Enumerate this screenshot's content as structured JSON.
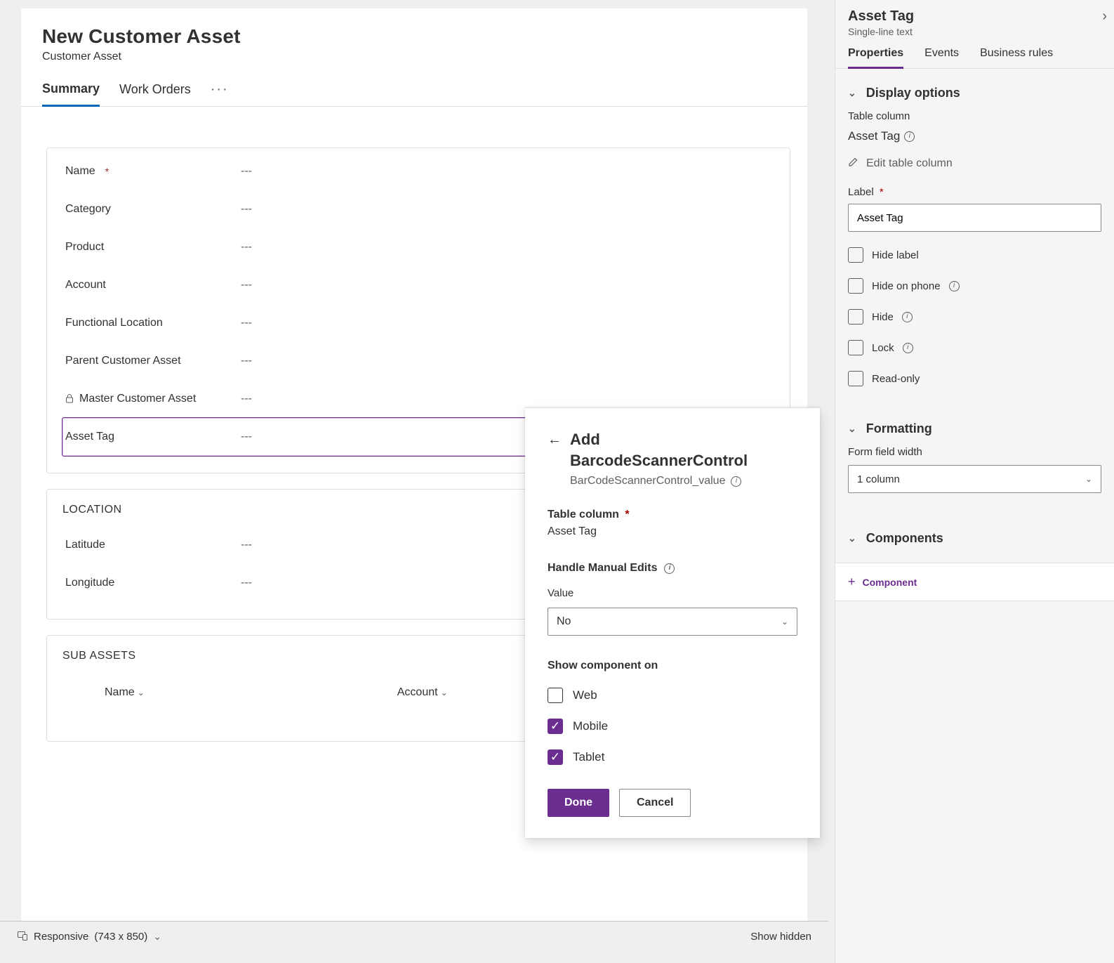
{
  "form": {
    "title": "New Customer Asset",
    "subtitle": "Customer Asset",
    "tabs": [
      {
        "label": "Summary",
        "active": true
      },
      {
        "label": "Work Orders",
        "active": false
      }
    ],
    "fields": [
      {
        "label": "Name",
        "required": true,
        "value": "---",
        "locked": false
      },
      {
        "label": "Category",
        "required": false,
        "value": "---",
        "locked": false
      },
      {
        "label": "Product",
        "required": false,
        "value": "---",
        "locked": false
      },
      {
        "label": "Account",
        "required": false,
        "value": "---",
        "locked": false
      },
      {
        "label": "Functional Location",
        "required": false,
        "value": "---",
        "locked": false
      },
      {
        "label": "Parent Customer Asset",
        "required": false,
        "value": "---",
        "locked": false
      },
      {
        "label": "Master Customer Asset",
        "required": false,
        "value": "---",
        "locked": true
      },
      {
        "label": "Asset Tag",
        "required": false,
        "value": "---",
        "locked": false,
        "selected": true
      }
    ],
    "location": {
      "title": "LOCATION",
      "fields": [
        {
          "label": "Latitude",
          "value": "---"
        },
        {
          "label": "Longitude",
          "value": "---"
        }
      ]
    },
    "subassets": {
      "title": "SUB ASSETS",
      "columns": [
        "Name",
        "Account"
      ]
    }
  },
  "footer": {
    "mode": "Responsive",
    "dimensions": "(743 x 850)",
    "show_hidden_label": "Show hidden"
  },
  "popover": {
    "title_a": "Add",
    "title_b": "BarcodeScannerControl",
    "subtitle": "BarCodeScannerControl_value",
    "table_column": {
      "label": "Table column",
      "value": "Asset Tag"
    },
    "handle": "Handle Manual Edits",
    "value_label": "Value",
    "value_selected": "No",
    "show_on": {
      "label": "Show component on",
      "options": [
        {
          "label": "Web",
          "checked": false
        },
        {
          "label": "Mobile",
          "checked": true
        },
        {
          "label": "Tablet",
          "checked": true
        }
      ]
    },
    "done": "Done",
    "cancel": "Cancel"
  },
  "right_panel": {
    "title": "Asset Tag",
    "subtitle": "Single-line text",
    "tabs": [
      "Properties",
      "Events",
      "Business rules"
    ],
    "display_options": {
      "heading": "Display options",
      "table_column_label": "Table column",
      "table_column_value": "Asset Tag",
      "edit_table_column": "Edit table column",
      "label_label": "Label",
      "label_value": "Asset Tag",
      "checks": [
        {
          "label": "Hide label",
          "info": false
        },
        {
          "label": "Hide on phone",
          "info": true
        },
        {
          "label": "Hide",
          "info": true
        },
        {
          "label": "Lock",
          "info": true
        },
        {
          "label": "Read-only",
          "info": false
        }
      ]
    },
    "formatting": {
      "heading": "Formatting",
      "field_width_label": "Form field width",
      "field_width_value": "1 column"
    },
    "components": {
      "heading": "Components",
      "add_label": "Component"
    }
  }
}
